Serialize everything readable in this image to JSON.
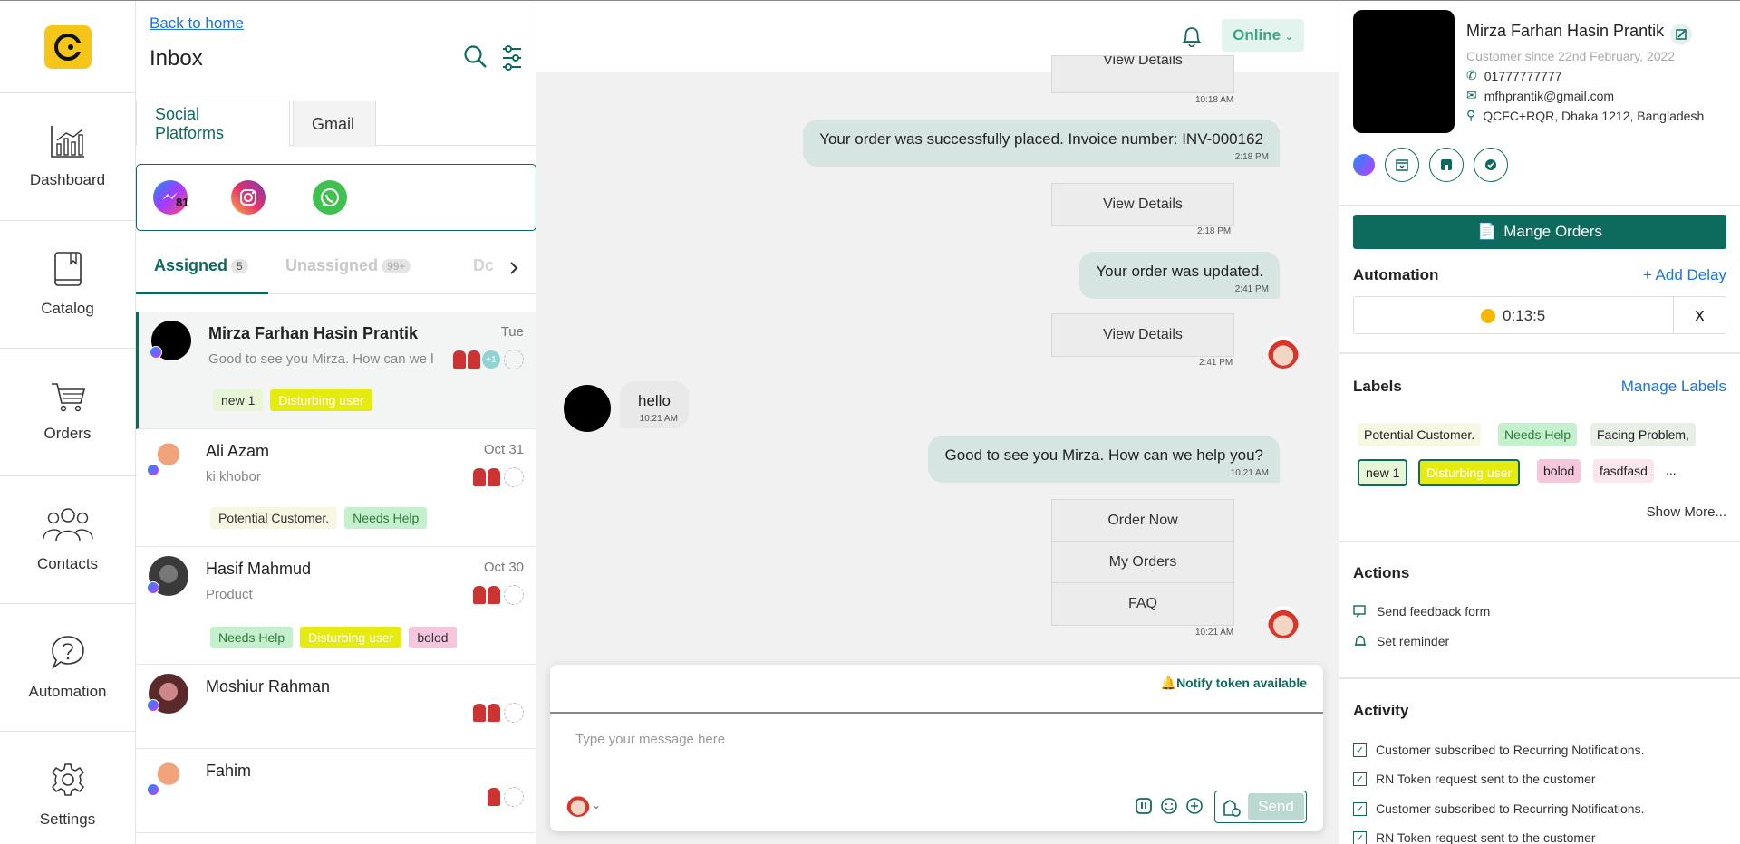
{
  "nav": {
    "items": [
      {
        "label": "Dashboard",
        "icon": "dashboard-chart-icon"
      },
      {
        "label": "Catalog",
        "icon": "catalog-book-icon"
      },
      {
        "label": "Orders",
        "icon": "cart-icon"
      },
      {
        "label": "Contacts",
        "icon": "people-icon"
      },
      {
        "label": "Automation",
        "icon": "question-bubble-icon"
      },
      {
        "label": "Settings",
        "icon": "gear-icon"
      }
    ]
  },
  "inbox": {
    "back_link": "Back to home",
    "title": "Inbox",
    "platform_tabs": [
      "Social Platforms",
      "Gmail"
    ],
    "messenger_count": "81",
    "assign_tabs": {
      "assigned": "Assigned",
      "assigned_count": "5",
      "unassigned": "Unassigned",
      "unassigned_count": "99+",
      "done": "Dc"
    },
    "conversations": [
      {
        "name": "Mirza Farhan Hasin Prantik",
        "date": "Tue",
        "preview": "Good to see you Mirza. How can we help you?",
        "extra_agents": "+1",
        "tags": [
          "new 1",
          "Disturbing user"
        ]
      },
      {
        "name": "Ali Azam",
        "date": "Oct 31",
        "preview": "ki khobor",
        "tags": [
          "Potential Customer.",
          "Needs Help"
        ]
      },
      {
        "name": "Hasif Mahmud",
        "date": "Oct 30",
        "preview": "Product",
        "tags": [
          "Needs Help",
          "Disturbing user",
          "bolod"
        ]
      },
      {
        "name": "Moshiur Rahman",
        "date": "",
        "preview": "",
        "tags": []
      },
      {
        "name": "Fahim",
        "date": "",
        "preview": "",
        "tags": []
      }
    ]
  },
  "chat": {
    "status": "Online",
    "messages": {
      "m0_btn": "View Details",
      "m0_time": "10:18 AM",
      "m1_text": "Your order was successfully placed. Invoice number: INV-000162",
      "m1_time": "2:18 PM",
      "m2_btn": "View Details",
      "m2_time": "2:18 PM",
      "m3_text": "Your order was updated.",
      "m3_time": "2:41 PM",
      "m4_btn": "View Details",
      "m4_time": "2:41 PM",
      "m5_text": "hello",
      "m5_time": "10:21 AM",
      "m6_text": "Good to see you Mirza. How can we help you?",
      "m6_time": "10:21 AM",
      "m7_buttons": [
        "Order Now",
        "My Orders",
        "FAQ"
      ],
      "m7_time": "10:21 AM"
    },
    "composer": {
      "notify": "Notify token available",
      "placeholder": "Type your message here",
      "send": "Send"
    }
  },
  "profile": {
    "name": "Mirza Farhan Hasin Prantik",
    "since": "Customer since 22nd February, 2022",
    "phone": "01777777777",
    "email": "mfhprantik@gmail.com",
    "address": "QCFC+RQR, Dhaka 1212, Bangladesh",
    "manage_orders": "Mange Orders",
    "automation_title": "Automation",
    "add_delay": "+ Add Delay",
    "timer": "0:13:5",
    "timer_close": "x",
    "labels_title": "Labels",
    "manage_labels": "Manage Labels",
    "labels": [
      "Potential Customer.",
      "Needs Help",
      "Facing Problem,",
      "new 1",
      "Disturbing user",
      "bolod",
      "fasdfasd"
    ],
    "labels_more": "...",
    "show_more": "Show More...",
    "actions_title": "Actions",
    "actions": [
      "Send feedback form",
      "Set reminder"
    ],
    "activity_title": "Activity",
    "activity": [
      "Customer subscribed to Recurring Notifications.",
      "RN Token request sent to the customer",
      "Customer subscribed to Recurring Notifications.",
      "RN Token request sent to the customer"
    ]
  },
  "colors": {
    "brand": "#0d6b5e",
    "logo": "#f5c518",
    "bubble_out": "#d6e5e1"
  }
}
